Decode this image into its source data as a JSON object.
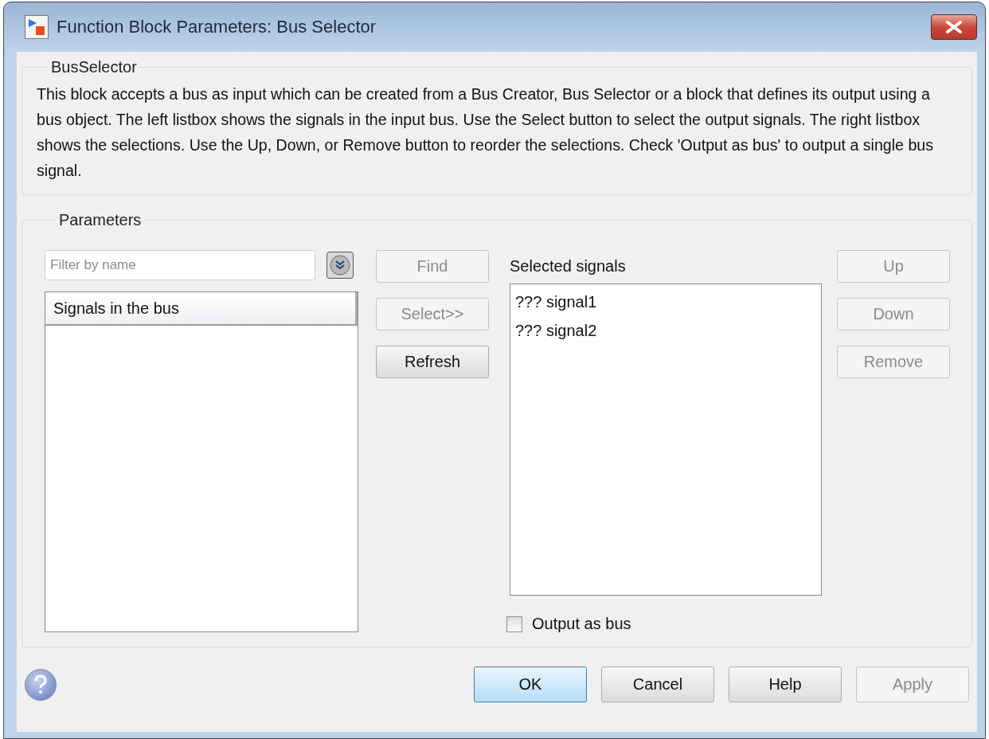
{
  "window": {
    "title": "Function Block Parameters: Bus Selector"
  },
  "description_group": {
    "label": "BusSelector",
    "text": "This block accepts a bus as input which can be created from a Bus Creator, Bus Selector or a block that defines its output using a bus object. The left listbox shows the signals in the input bus. Use the Select button to select the output signals. The right listbox shows the selections. Use the Up, Down, or Remove button to reorder the selections. Check 'Output as bus' to output a single bus signal."
  },
  "parameters": {
    "label": "Parameters",
    "filter": {
      "placeholder": "Filter by name"
    },
    "signals_list": {
      "header": "Signals in the bus"
    },
    "middle_buttons": [
      {
        "label": "Find",
        "disabled": true
      },
      {
        "label": "Select>>",
        "disabled": true
      },
      {
        "label": "Refresh",
        "disabled": false
      }
    ],
    "selected_signals": {
      "label": "Selected signals",
      "items": [
        {
          "text": "??? signal1"
        },
        {
          "text": "??? signal2"
        }
      ]
    },
    "order_buttons": [
      {
        "label": "Up",
        "disabled": true
      },
      {
        "label": "Down",
        "disabled": true
      },
      {
        "label": "Remove",
        "disabled": true
      }
    ],
    "output_as_bus": {
      "label": "Output as bus",
      "checked": false
    }
  },
  "footer_buttons": [
    {
      "label": "OK",
      "default": true,
      "disabled": false
    },
    {
      "label": "Cancel",
      "default": false,
      "disabled": false
    },
    {
      "label": "Help",
      "default": false,
      "disabled": false
    },
    {
      "label": "Apply",
      "default": false,
      "disabled": true
    }
  ]
}
